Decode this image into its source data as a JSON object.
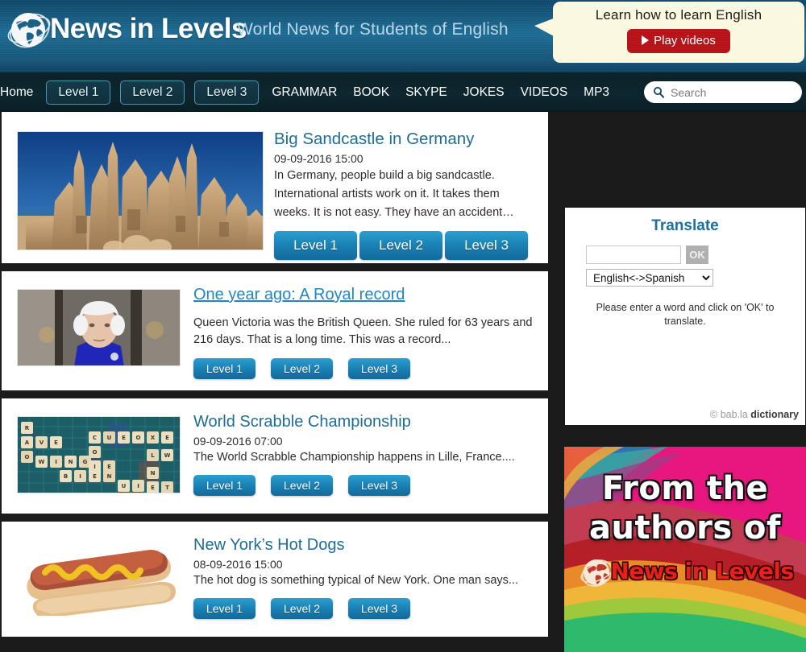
{
  "header": {
    "brand": "News in Levels",
    "tagline": "World News for Students of English",
    "logo_icon": "globe-icon"
  },
  "callout": {
    "title": "Learn how to learn English",
    "button_label": "Play videos",
    "button_icon": "play-triangle-icon",
    "button_color": "#b71217",
    "background": "#fbf8e0"
  },
  "nav": {
    "home_label": "Home",
    "level_buttons": [
      "Level 1",
      "Level 2",
      "Level 3"
    ],
    "links": [
      "GRAMMAR",
      "BOOK",
      "SKYPE",
      "JOKES",
      "VIDEOS",
      "MP3"
    ],
    "search": {
      "placeholder": "Search",
      "value": "",
      "icon": "search-icon"
    }
  },
  "articles": [
    {
      "title": "Big Sandcastle in Germany",
      "date": "09-09-2016 15:00",
      "summary": "In Germany, people build a big sandcastle. International artists work on it. It takes them weeks. It is not easy. They have an accident…",
      "image_alt": "sandcastle-photo",
      "levels": [
        "Level 1",
        "Level 2",
        "Level 3"
      ],
      "hovered": false
    },
    {
      "title": "One year ago: A Royal record",
      "date": "",
      "summary": "Queen Victoria was the British Queen. She ruled for 63 years and 216 days. That is a long time. This was a record...",
      "image_alt": "queen-elizabeth-photo",
      "levels": [
        "Level 1",
        "Level 2",
        "Level 3"
      ],
      "hovered": true
    },
    {
      "title": "World Scrabble Championship",
      "date": "09-09-2016 07:00",
      "summary": "The World Scrabble Championship happens in Lille, France....",
      "image_alt": "scrabble-board-photo",
      "levels": [
        "Level 1",
        "Level 2",
        "Level 3"
      ],
      "hovered": false
    },
    {
      "title": "New York’s Hot Dogs",
      "date": "08-09-2016 15:00",
      "summary": "The hot dog is something typical of New York. One man says...",
      "image_alt": "hot-dog-photo",
      "levels": [
        "Level 1",
        "Level 2",
        "Level 3"
      ],
      "hovered": false
    }
  ],
  "translate": {
    "title": "Translate",
    "input_value": "",
    "ok_label": "OK",
    "selected_language_pair": "English<->Spanish",
    "language_options": [
      "English<->Spanish"
    ],
    "hint": "Please enter a word and click on 'OK' to translate.",
    "credit_prefix": "© bab.la ",
    "credit_suffix": "dictionary",
    "title_color": "#1e6f9b"
  },
  "promo": {
    "line1": "From the",
    "line2": "authors of",
    "brand": "News in Levels",
    "brand_color": "#e8201d",
    "globe_icon": "globe-icon"
  }
}
